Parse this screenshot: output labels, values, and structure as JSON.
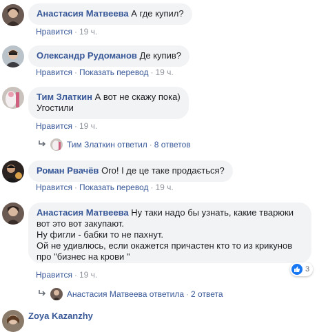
{
  "comments": [
    {
      "author": "Анастасия Матвеева",
      "text": "А где купил?",
      "actions": {
        "like": "Нравится",
        "time": "19 ч."
      }
    },
    {
      "author": "Олександр Рудоманов",
      "text": "Де купив?",
      "actions": {
        "like": "Нравится",
        "translate": "Показать перевод",
        "time": "19 ч."
      }
    },
    {
      "author": "Тим Златкин",
      "text": "А вот не скажу пока)",
      "text2": "Угостили",
      "actions": {
        "like": "Нравится",
        "time": "19 ч."
      },
      "replies": {
        "who": "Тим Златкин ответил",
        "count": "8 ответов"
      }
    },
    {
      "author": "Роман Рвачёв",
      "text": "Ого! І де це таке продається?",
      "actions": {
        "like": "Нравится",
        "translate": "Показать перевод",
        "time": "19 ч."
      }
    },
    {
      "author": "Анастасия Матвеева",
      "text": "Ну таки надо бы узнать, какие тварюки",
      "text2": "вот это вот закупают.",
      "text3": "Ну фигли - бабки то не пахнут.",
      "text4": "Ой не удивлюсь, если окажется причастен кто то из крикунов",
      "text5": "про \"бизнес на крови \"",
      "reactions": {
        "icon": "like-icon",
        "count": "3"
      },
      "actions": {
        "like": "Нравится",
        "time": "19 ч."
      },
      "replies": {
        "who": "Анастасия Матвеева ответила",
        "count": "2 ответа"
      }
    },
    {
      "author": "Zoya Kazanzhy"
    }
  ],
  "colors": {
    "link": "#385898",
    "bubble": "#f2f3f5",
    "meta": "#90949c",
    "like": "#1877f2"
  }
}
